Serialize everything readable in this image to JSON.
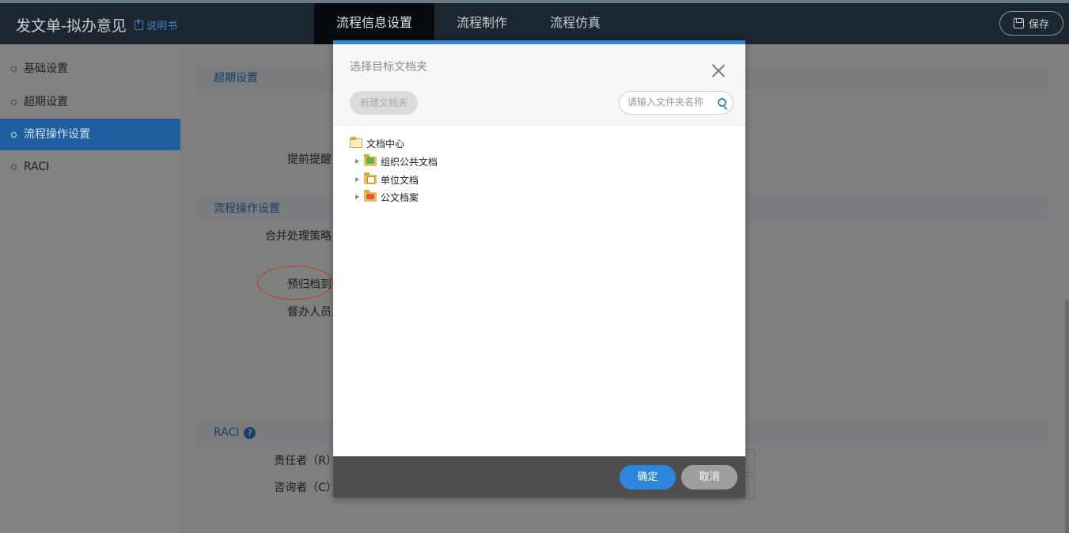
{
  "header": {
    "title": "发文单-拟办意见",
    "manual_label": "说明书",
    "tabs": [
      {
        "label": "流程信息设置",
        "active": true
      },
      {
        "label": "流程制作",
        "active": false
      },
      {
        "label": "流程仿真",
        "active": false
      }
    ],
    "save_label": "保存"
  },
  "sidebar": {
    "items": [
      {
        "label": "基础设置",
        "active": false
      },
      {
        "label": "超期设置",
        "active": false
      },
      {
        "label": "流程操作设置",
        "active": true
      },
      {
        "label": "RACI",
        "active": false
      }
    ]
  },
  "main": {
    "sections": {
      "overdue": "超期设置",
      "flow_ops": "流程操作设置",
      "raci": "RACI"
    },
    "labels": {
      "advance_reminder": "提前提醒：",
      "merge_strategy": "合并处理策略：",
      "pre_archive": "预归档到：",
      "supervisor": "督办人员：",
      "responsible": "责任者（R）：",
      "consulted": "咨询者（C）："
    },
    "help_symbol": "?"
  },
  "modal": {
    "title": "选择目标文档夹",
    "new_folder_label": "新建文档夹",
    "search_placeholder": "请输入文件夹名称",
    "tree": {
      "root": "文档中心",
      "children": [
        "组织公共文档",
        "单位文档",
        "公文档案"
      ]
    },
    "ok_label": "确定",
    "cancel_label": "取消"
  },
  "colors": {
    "accent": "#2d86dc",
    "header_bg": "#1b2631",
    "sidebar_active": "#1f5fa0",
    "highlight_ellipse": "#c0392b"
  }
}
